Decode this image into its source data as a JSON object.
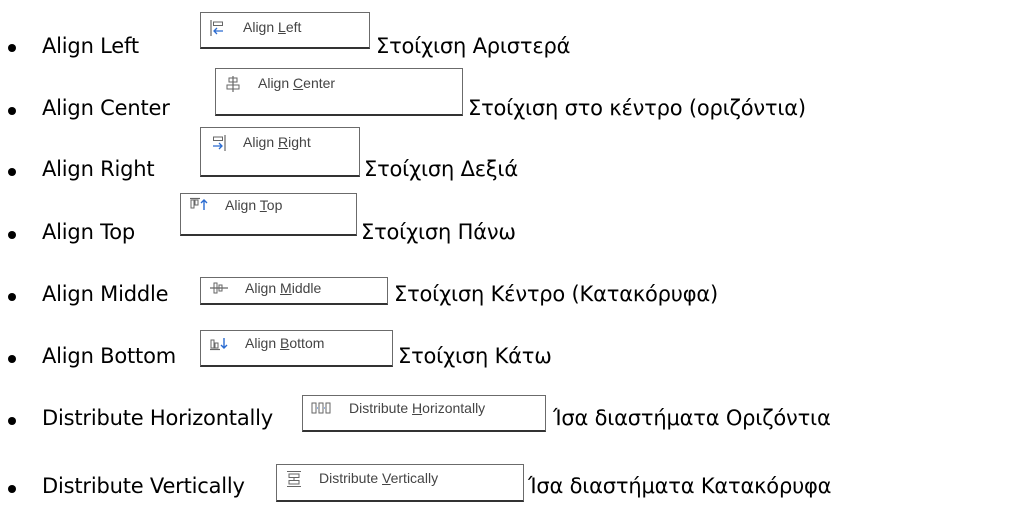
{
  "items": [
    {
      "label": "Align Left",
      "btn_pre": "Align ",
      "btn_ul": "L",
      "btn_post": "eft",
      "icon": "align-left-icon",
      "greek": "Στοίχιση Αριστερά"
    },
    {
      "label": "Align Center",
      "btn_pre": "Align ",
      "btn_ul": "C",
      "btn_post": "enter",
      "icon": "align-center-icon",
      "greek": "Στοίχιση στο κέντρο (οριζόντια)"
    },
    {
      "label": "Align Right",
      "btn_pre": "Align ",
      "btn_ul": "R",
      "btn_post": "ight",
      "icon": "align-right-icon",
      "greek": "Στοίχιση Δεξιά"
    },
    {
      "label": "Align Top",
      "btn_pre": "Align ",
      "btn_ul": "T",
      "btn_post": "op",
      "icon": "align-top-icon",
      "greek": "Στοίχιση Πάνω"
    },
    {
      "label": "Align Middle",
      "btn_pre": "Align ",
      "btn_ul": "M",
      "btn_post": "iddle",
      "icon": "align-middle-icon",
      "greek": "Στοίχιση Κέντρο (Κατακόρυφα)"
    },
    {
      "label": "Align Bottom",
      "btn_pre": "Align ",
      "btn_ul": "B",
      "btn_post": "ottom",
      "icon": "align-bottom-icon",
      "greek": "Στοίχιση Κάτω"
    },
    {
      "label": "Distribute Horizontally",
      "btn_pre": "Distribute ",
      "btn_ul": "H",
      "btn_post": "orizontally",
      "icon": "distribute-horizontally-icon",
      "greek": "Ίσα διαστήματα Οριζόντια"
    },
    {
      "label": "Distribute Vertically",
      "btn_pre": "Distribute ",
      "btn_ul": "V",
      "btn_post": "ertically",
      "icon": "distribute-vertically-icon",
      "greek": "Ίσα διαστήματα Κατακόρυφα"
    }
  ]
}
